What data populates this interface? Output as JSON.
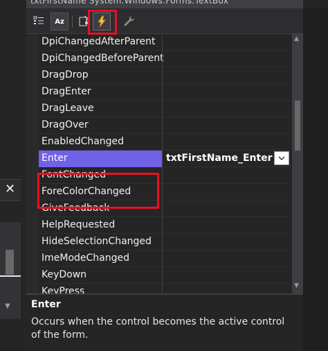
{
  "title_strip": "txtFirstName System.Windows.Forms.TextBox",
  "toolbar": {
    "categorized_label": "Categorized",
    "alphabetical_label": "Az",
    "properties_label": "Properties",
    "events_label": "Events",
    "property_pages_label": "Property Pages"
  },
  "left_panel": {
    "close_label": "✕"
  },
  "events": [
    {
      "name": "DpiChangedAfterParent",
      "value": ""
    },
    {
      "name": "DpiChangedBeforeParent",
      "value": ""
    },
    {
      "name": "DragDrop",
      "value": ""
    },
    {
      "name": "DragEnter",
      "value": ""
    },
    {
      "name": "DragLeave",
      "value": ""
    },
    {
      "name": "DragOver",
      "value": ""
    },
    {
      "name": "EnabledChanged",
      "value": ""
    },
    {
      "name": "Enter",
      "value": "txtFirstName_Enter"
    },
    {
      "name": "FontChanged",
      "value": ""
    },
    {
      "name": "ForeColorChanged",
      "value": ""
    },
    {
      "name": "GiveFeedback",
      "value": ""
    },
    {
      "name": "HelpRequested",
      "value": ""
    },
    {
      "name": "HideSelectionChanged",
      "value": ""
    },
    {
      "name": "ImeModeChanged",
      "value": ""
    },
    {
      "name": "KeyDown",
      "value": ""
    },
    {
      "name": "KeyPress",
      "value": ""
    }
  ],
  "selected_index": 7,
  "description": {
    "title": "Enter",
    "text": "Occurs when the control becomes the active control of the form."
  },
  "colors": {
    "selection": "#7160e8",
    "highlight_box": "#e81123",
    "background": "#252526"
  }
}
